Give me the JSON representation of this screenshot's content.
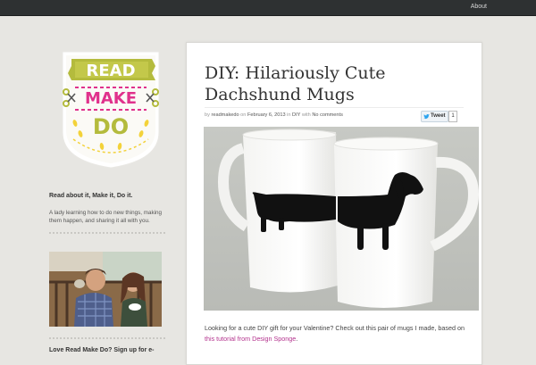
{
  "topbar": {
    "about_label": "About"
  },
  "logo": {
    "word1": "READ",
    "word2": "MAKE",
    "word3": "DO"
  },
  "sidebar": {
    "tagline_heading": "Read about it, Make it, Do it.",
    "tagline_text": "A lady learning how to do new things, making them happen, and sharing it all with you.",
    "signup_heading": "Love Read Make Do? Sign up for e-"
  },
  "post": {
    "title": "DIY: Hilariously Cute Dachshund Mugs",
    "meta_by": "by",
    "meta_author": "readmakedo",
    "meta_on": "on",
    "meta_date": "February 6, 2013",
    "meta_in": "in",
    "meta_category": "DIY",
    "meta_with": "with",
    "meta_comments": "No comments",
    "tweet_label": "Tweet",
    "tweet_count": "1",
    "body_text": "Looking for a cute DIY gift for your Valentine? Check out this pair of mugs I made, based on",
    "body_link": "this tutorial from Design Sponge",
    "body_end": "."
  },
  "colors": {
    "accent_link": "#b3328d",
    "topbar": "#2e3132",
    "background": "#e7e6e2",
    "logo_olive": "#b4bb3d",
    "logo_pink": "#e0318c",
    "logo_yellow": "#f3d23a"
  }
}
